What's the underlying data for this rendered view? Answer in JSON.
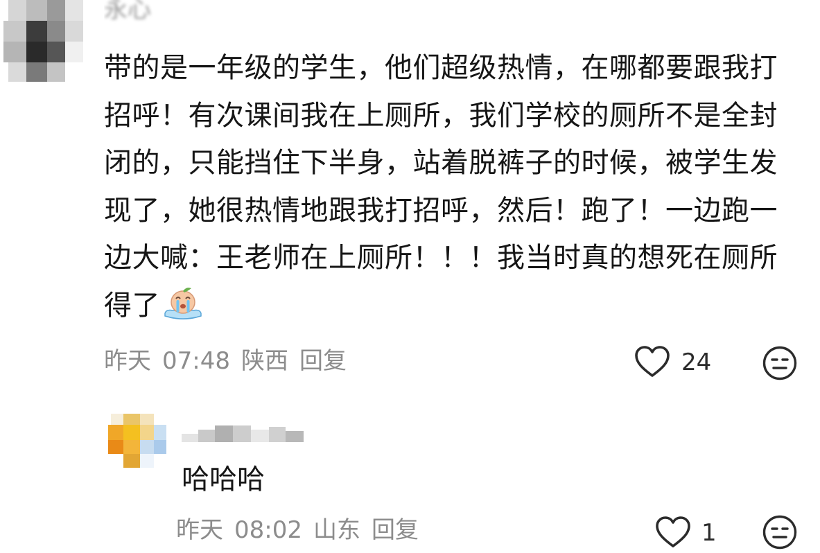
{
  "comment": {
    "author": "永心",
    "text": "带的是一年级的学生，他们超级热情，在哪都要跟我打招呼！有次课间我在上厕所，我们学校的厕所不是全封闭的，只能挡住下半身，站着脱裤子的时候，被学生发现了，她很热情地跟我打招呼，然后！跑了！一边跑一边大喊：王老师在上厕所！！！我当时真的想死在厕所得了",
    "emoji_icon": "crying-emoji-icon",
    "date": "昨天",
    "time": "07:48",
    "location": "陕西",
    "reply_label": "回复",
    "likes": "24"
  },
  "reply": {
    "text": "哈哈哈",
    "date": "昨天",
    "time": "08:02",
    "location": "山东",
    "reply_label": "回复",
    "likes": "1"
  },
  "colors": {
    "text": "#161616",
    "meta": "#8c8c8c",
    "icon": "#2b2b2b"
  }
}
